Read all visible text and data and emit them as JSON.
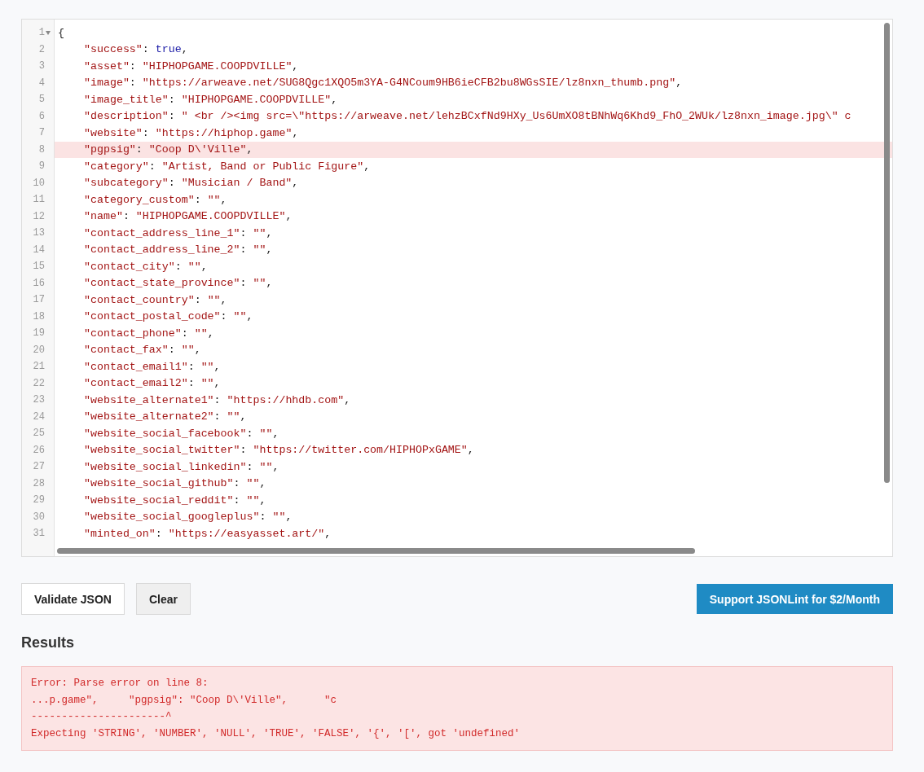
{
  "editor": {
    "lines": [
      {
        "n": "1",
        "kind": "open",
        "brace": "{",
        "error": false
      },
      {
        "n": "2",
        "kind": "literal",
        "key": "\"success\"",
        "colon": ": ",
        "value": "true",
        "comma": ",",
        "error": false
      },
      {
        "n": "3",
        "kind": "string",
        "key": "\"asset\"",
        "colon": ": ",
        "value": "\"HIPHOPGAME.COOPDVILLE\"",
        "comma": ",",
        "error": false
      },
      {
        "n": "4",
        "kind": "string",
        "key": "\"image\"",
        "colon": ": ",
        "value": "\"https://arweave.net/SUG8Qgc1XQO5m3YA-G4NCoum9HB6ieCFB2bu8WGsSIE/lz8nxn_thumb.png\"",
        "comma": ",",
        "error": false
      },
      {
        "n": "5",
        "kind": "string",
        "key": "\"image_title\"",
        "colon": ": ",
        "value": "\"HIPHOPGAME.COOPDVILLE\"",
        "comma": ",",
        "error": false
      },
      {
        "n": "6",
        "kind": "string",
        "key": "\"description\"",
        "colon": ": ",
        "value": "\" <br /><img src=\\\"https://arweave.net/lehzBCxfNd9HXy_Us6UmXO8tBNhWq6Khd9_FhO_2WUk/lz8nxn_image.jpg\\\" c",
        "error": false
      },
      {
        "n": "7",
        "kind": "string",
        "key": "\"website\"",
        "colon": ": ",
        "value": "\"https://hiphop.game\"",
        "comma": ",",
        "error": false
      },
      {
        "n": "8",
        "kind": "string",
        "key": "\"pgpsig\"",
        "colon": ": ",
        "value": "\"Coop D\\'Ville\"",
        "comma": ",",
        "error": true
      },
      {
        "n": "9",
        "kind": "string",
        "key": "\"category\"",
        "colon": ": ",
        "value": "\"Artist, Band or Public Figure\"",
        "comma": ",",
        "error": false
      },
      {
        "n": "10",
        "kind": "string",
        "key": "\"subcategory\"",
        "colon": ": ",
        "value": "\"Musician / Band\"",
        "comma": ",",
        "error": false
      },
      {
        "n": "11",
        "kind": "string",
        "key": "\"category_custom\"",
        "colon": ": ",
        "value": "\"\"",
        "comma": ",",
        "error": false
      },
      {
        "n": "12",
        "kind": "string",
        "key": "\"name\"",
        "colon": ": ",
        "value": "\"HIPHOPGAME.COOPDVILLE\"",
        "comma": ",",
        "error": false
      },
      {
        "n": "13",
        "kind": "string",
        "key": "\"contact_address_line_1\"",
        "colon": ": ",
        "value": "\"\"",
        "comma": ",",
        "error": false
      },
      {
        "n": "14",
        "kind": "string",
        "key": "\"contact_address_line_2\"",
        "colon": ": ",
        "value": "\"\"",
        "comma": ",",
        "error": false
      },
      {
        "n": "15",
        "kind": "string",
        "key": "\"contact_city\"",
        "colon": ": ",
        "value": "\"\"",
        "comma": ",",
        "error": false
      },
      {
        "n": "16",
        "kind": "string",
        "key": "\"contact_state_province\"",
        "colon": ": ",
        "value": "\"\"",
        "comma": ",",
        "error": false
      },
      {
        "n": "17",
        "kind": "string",
        "key": "\"contact_country\"",
        "colon": ": ",
        "value": "\"\"",
        "comma": ",",
        "error": false
      },
      {
        "n": "18",
        "kind": "string",
        "key": "\"contact_postal_code\"",
        "colon": ": ",
        "value": "\"\"",
        "comma": ",",
        "error": false
      },
      {
        "n": "19",
        "kind": "string",
        "key": "\"contact_phone\"",
        "colon": ": ",
        "value": "\"\"",
        "comma": ",",
        "error": false
      },
      {
        "n": "20",
        "kind": "string",
        "key": "\"contact_fax\"",
        "colon": ": ",
        "value": "\"\"",
        "comma": ",",
        "error": false
      },
      {
        "n": "21",
        "kind": "string",
        "key": "\"contact_email1\"",
        "colon": ": ",
        "value": "\"\"",
        "comma": ",",
        "error": false
      },
      {
        "n": "22",
        "kind": "string",
        "key": "\"contact_email2\"",
        "colon": ": ",
        "value": "\"\"",
        "comma": ",",
        "error": false
      },
      {
        "n": "23",
        "kind": "string",
        "key": "\"website_alternate1\"",
        "colon": ": ",
        "value": "\"https://hhdb.com\"",
        "comma": ",",
        "error": false
      },
      {
        "n": "24",
        "kind": "string",
        "key": "\"website_alternate2\"",
        "colon": ": ",
        "value": "\"\"",
        "comma": ",",
        "error": false
      },
      {
        "n": "25",
        "kind": "string",
        "key": "\"website_social_facebook\"",
        "colon": ": ",
        "value": "\"\"",
        "comma": ",",
        "error": false
      },
      {
        "n": "26",
        "kind": "string",
        "key": "\"website_social_twitter\"",
        "colon": ": ",
        "value": "\"https://twitter.com/HIPHOPxGAME\"",
        "comma": ",",
        "error": false
      },
      {
        "n": "27",
        "kind": "string",
        "key": "\"website_social_linkedin\"",
        "colon": ": ",
        "value": "\"\"",
        "comma": ",",
        "error": false
      },
      {
        "n": "28",
        "kind": "string",
        "key": "\"website_social_github\"",
        "colon": ": ",
        "value": "\"\"",
        "comma": ",",
        "error": false
      },
      {
        "n": "29",
        "kind": "string",
        "key": "\"website_social_reddit\"",
        "colon": ": ",
        "value": "\"\"",
        "comma": ",",
        "error": false
      },
      {
        "n": "30",
        "kind": "string",
        "key": "\"website_social_googleplus\"",
        "colon": ": ",
        "value": "\"\"",
        "comma": ",",
        "error": false
      },
      {
        "n": "31",
        "kind": "string",
        "key": "\"minted_on\"",
        "colon": ": ",
        "value": "\"https://easyasset.art/\"",
        "comma": ",",
        "error": false
      }
    ]
  },
  "buttons": {
    "validate": "Validate JSON",
    "clear": "Clear",
    "support": "Support JSONLint for $2/Month"
  },
  "results": {
    "heading": "Results",
    "error_lines": [
      "Error: Parse error on line 8:",
      "...p.game\",     \"pgpsig\": \"Coop D\\'Ville\",      \"c",
      "----------------------^",
      "Expecting 'STRING', 'NUMBER', 'NULL', 'TRUE', 'FALSE', '{', '[', got 'undefined'"
    ]
  }
}
